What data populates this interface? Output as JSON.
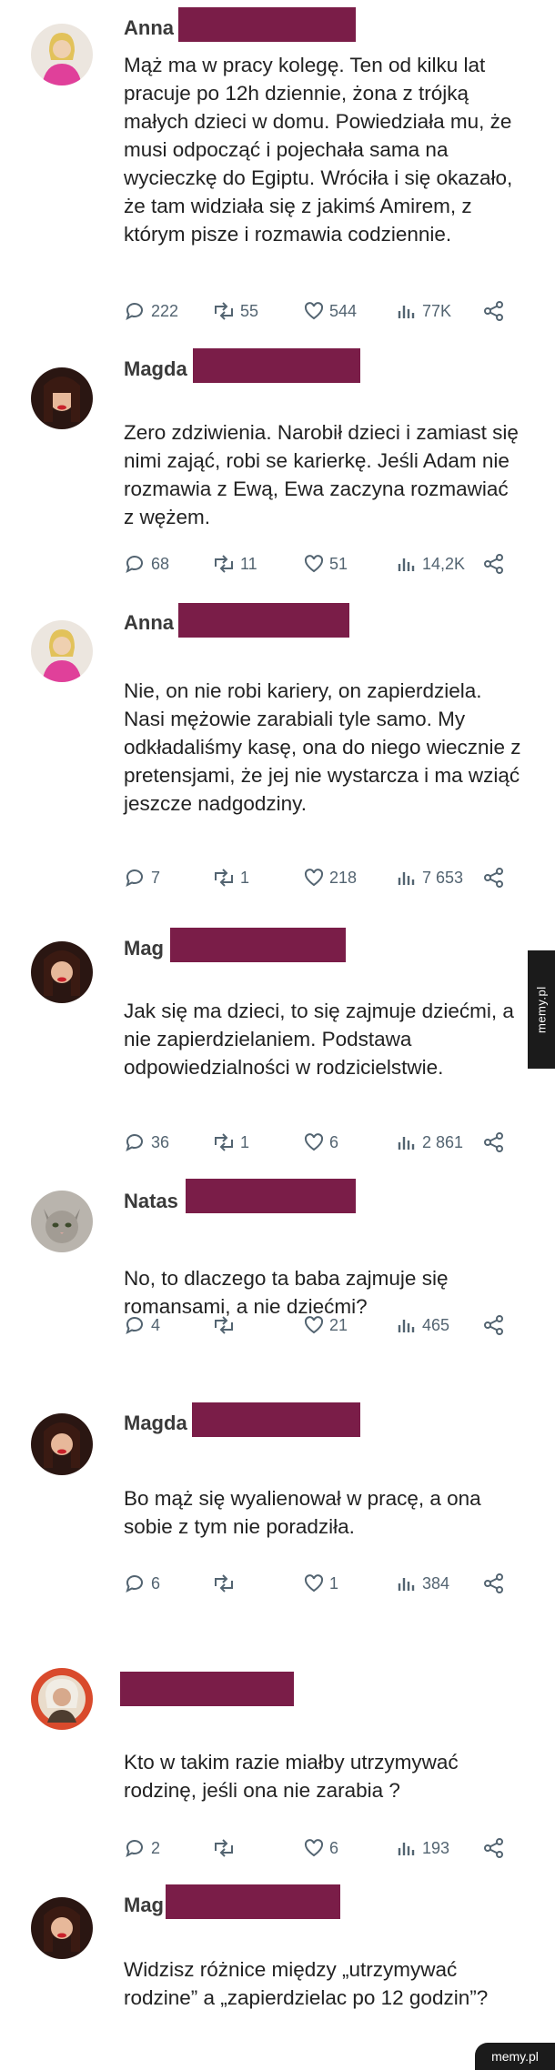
{
  "posts": [
    {
      "name": "Anna",
      "text": "Mąż ma w pracy kolegę. Ten od kilku lat pracuje po 12h dziennie, żona z trójką małych dzieci w domu. Powiedziała mu, że musi odpocząć i pojechała sama na wycieczkę do Egiptu. Wróciła i się okazało, że tam widziała się z jakimś Amirem, z którym pisze i rozmawia codziennie.",
      "replies": "222",
      "reposts": "55",
      "likes": "544",
      "views": "77K"
    },
    {
      "name": "Magda",
      "text": "Zero zdziwienia. Narobił dzieci i zamiast się nimi zająć, robi se karierkę. Jeśli Adam nie rozmawia z Ewą, Ewa zaczyna rozmawiać z wężem.",
      "replies": "68",
      "reposts": "11",
      "likes": "51",
      "views": "14,2K"
    },
    {
      "name": "Anna",
      "text": "Nie, on nie robi kariery, on zapierdziela. Nasi mężowie zarabiali tyle samo. My odkładaliśmy kasę, ona do niego wiecznie z pretensjami, że jej nie wystarcza i ma wziąć jeszcze nadgodziny.",
      "replies": "7",
      "reposts": "1",
      "likes": "218",
      "views": "7 653"
    },
    {
      "name": "Mag",
      "text": "Jak się ma dzieci, to się zajmuje dziećmi, a nie zapierdzielaniem. Podstawa odpowiedzialności w rodzicielstwie.",
      "replies": "36",
      "reposts": "1",
      "likes": "6",
      "views": "2 861"
    },
    {
      "name": "Natas",
      "text": "No, to dlaczego ta baba zajmuje się romansami, a nie dziećmi?",
      "replies": "4",
      "reposts": "",
      "likes": "21",
      "views": "465"
    },
    {
      "name": "Magda",
      "text": "Bo mąż się wyalienował w pracę, a ona sobie z tym nie poradziła.",
      "replies": "6",
      "reposts": "",
      "likes": "1",
      "views": "384"
    },
    {
      "name": "",
      "text": "Kto w takim razie miałby utrzymywać rodzinę, jeśli ona nie zarabia ?",
      "replies": "2",
      "reposts": "",
      "likes": "6",
      "views": "193"
    },
    {
      "name": "Mag",
      "text": "Widzisz różnice między „utrzymywać rodzine” a „zapierdzielac po 12 godzin”?"
    }
  ],
  "watermark": "memy.pl",
  "colors": {
    "redaction": "#7a1d48",
    "action_gray": "#536471"
  },
  "icons": [
    "reply-icon",
    "repost-icon",
    "like-icon",
    "views-icon",
    "share-icon"
  ]
}
